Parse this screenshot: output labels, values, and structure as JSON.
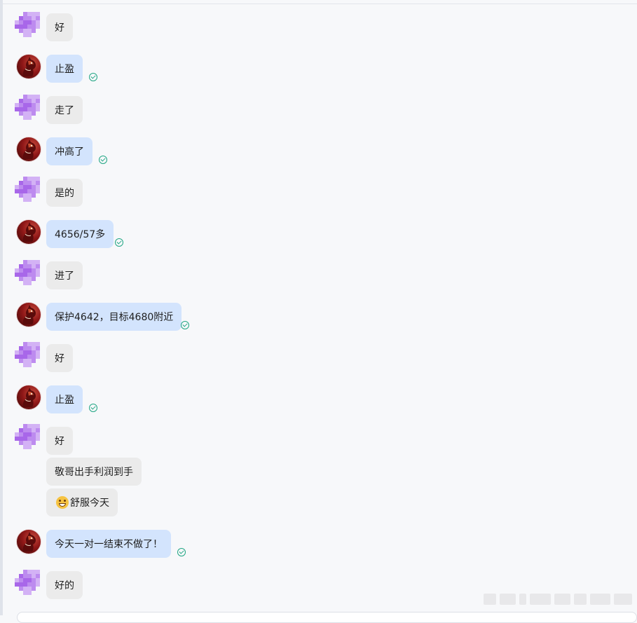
{
  "messages": [
    {
      "id": "m1",
      "direction": "in",
      "text": "好",
      "read": false
    },
    {
      "id": "m2",
      "direction": "out",
      "text": "止盈",
      "read": true
    },
    {
      "id": "m3",
      "direction": "in",
      "text": "走了",
      "read": false
    },
    {
      "id": "m4",
      "direction": "out",
      "text": "冲高了",
      "read": true
    },
    {
      "id": "m5",
      "direction": "in",
      "text": "是的",
      "read": false
    },
    {
      "id": "m6",
      "direction": "out",
      "text": "4656/57多",
      "read": true
    },
    {
      "id": "m7",
      "direction": "in",
      "text": "进了",
      "read": false
    },
    {
      "id": "m8",
      "direction": "out",
      "text": "保护4642，目标4680附近",
      "read": true
    },
    {
      "id": "m9",
      "direction": "in",
      "text": "好",
      "read": false
    },
    {
      "id": "m10",
      "direction": "out",
      "text": "止盈",
      "read": true
    },
    {
      "id": "m11",
      "direction": "in",
      "text": "好",
      "read": false
    },
    {
      "id": "m12",
      "direction": "in",
      "text": "敬哥出手利润到手",
      "read": false
    },
    {
      "id": "m13",
      "direction": "in",
      "text": "舒服今天",
      "emoji": "grinning-face-icon",
      "read": false
    },
    {
      "id": "m14",
      "direction": "out",
      "text": "今天一对一结束不做了！",
      "read": true
    },
    {
      "id": "m15",
      "direction": "in",
      "text": "好的",
      "read": false
    }
  ],
  "colors": {
    "incoming_bubble": "#ebebeb",
    "outgoing_bubble": "#d3e4fd",
    "read_check": "#21a684",
    "background": "#f7f8fa"
  },
  "icons": {
    "read": "check-circle-icon",
    "contact_avatar": "pixelated-avatar",
    "self_avatar": "horse-avatar"
  }
}
